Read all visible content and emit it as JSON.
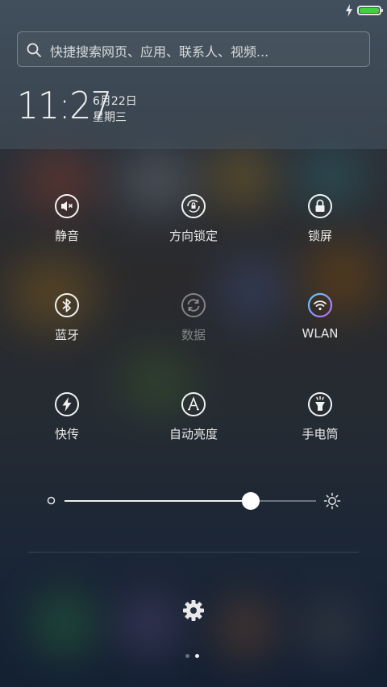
{
  "search": {
    "placeholder": "快捷搜索网页、应用、联系人、视频..."
  },
  "clock": {
    "time": "11:27",
    "date": "6月22日",
    "weekday": "星期三"
  },
  "toggles": [
    {
      "label": "静音",
      "icon": "mute-icon",
      "active": true
    },
    {
      "label": "方向锁定",
      "icon": "orientation-lock-icon",
      "active": true
    },
    {
      "label": "锁屏",
      "icon": "lock-icon",
      "active": true
    },
    {
      "label": "蓝牙",
      "icon": "bluetooth-icon",
      "active": true
    },
    {
      "label": "数据",
      "icon": "data-icon",
      "active": false
    },
    {
      "label": "WLAN",
      "icon": "wifi-icon",
      "active": true
    },
    {
      "label": "快传",
      "icon": "quick-transfer-icon",
      "active": true
    },
    {
      "label": "自动亮度",
      "icon": "auto-brightness-icon",
      "active": true
    },
    {
      "label": "手电筒",
      "icon": "flashlight-icon",
      "active": true
    }
  ],
  "brightness": {
    "level": 0.74
  },
  "status": {
    "battery_level": 1.0,
    "charging": true,
    "battery_color": "#3fd13f"
  },
  "pager": {
    "pages": 2,
    "current": 1
  },
  "colors": {
    "wifi_gradient_start": "#4fd1ff",
    "wifi_gradient_end": "#c266ff"
  }
}
